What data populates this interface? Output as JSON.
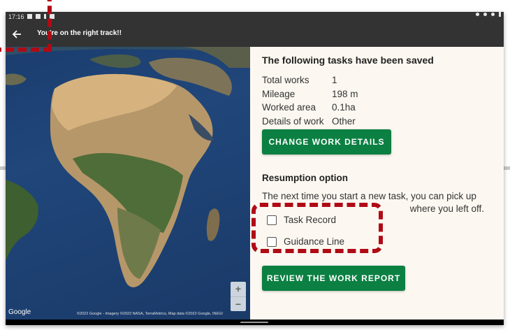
{
  "statusbar": {
    "time": "17:16"
  },
  "appbar": {
    "title": "You're on the right track!!"
  },
  "map": {
    "logo": "Google",
    "attribution": "©2022 Google - Imagery ©2022 NASA, TerraMetrics, Map data ©2022 Google, INEGI",
    "zoom_in": "+",
    "zoom_out": "−"
  },
  "panel": {
    "title": "The following tasks have been saved",
    "info": [
      {
        "label": "Total works",
        "value": "1"
      },
      {
        "label": "Mileage",
        "value": "198 m"
      },
      {
        "label": "Worked area",
        "value": "0.1ha"
      },
      {
        "label": "Details of work",
        "value": "Other"
      }
    ],
    "change_button": "CHANGE WORK DETAILS",
    "resumption_title": "Resumption option",
    "resumption_desc_line1": "The next time you start a new task, you can pick up",
    "resumption_desc_line2": "where you left off.",
    "options": [
      {
        "label": "Task Record",
        "checked": false
      },
      {
        "label": "Guidance Line",
        "checked": false
      }
    ],
    "review_button": "REVIEW THE WORK REPORT"
  },
  "colors": {
    "accent_green": "#0b8042",
    "highlight_red": "#b00a15",
    "appbar": "#333333",
    "panel_bg": "#fcf8f1"
  }
}
